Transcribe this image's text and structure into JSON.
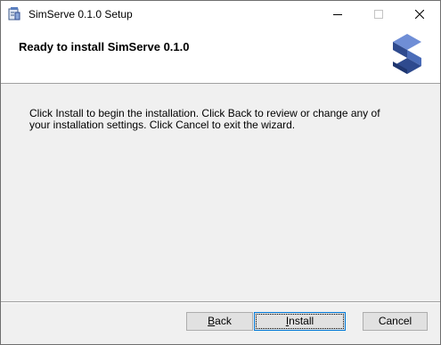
{
  "window": {
    "title": "SimServe 0.1.0 Setup"
  },
  "header": {
    "title": "Ready to install SimServe 0.1.0",
    "logo_icon": "simserve-logo-icon"
  },
  "body": {
    "text": "Click Install to begin the installation. Click Back to review or change any of your installation settings. Click Cancel to exit the wizard."
  },
  "buttons": {
    "back": {
      "first": "B",
      "rest": "ack"
    },
    "install": {
      "first": "I",
      "rest": "nstall"
    },
    "cancel": "Cancel"
  },
  "colors": {
    "logo_dark": "#2e4a8e",
    "logo_light": "#6f8ed6",
    "focus_border": "#0078d7"
  }
}
